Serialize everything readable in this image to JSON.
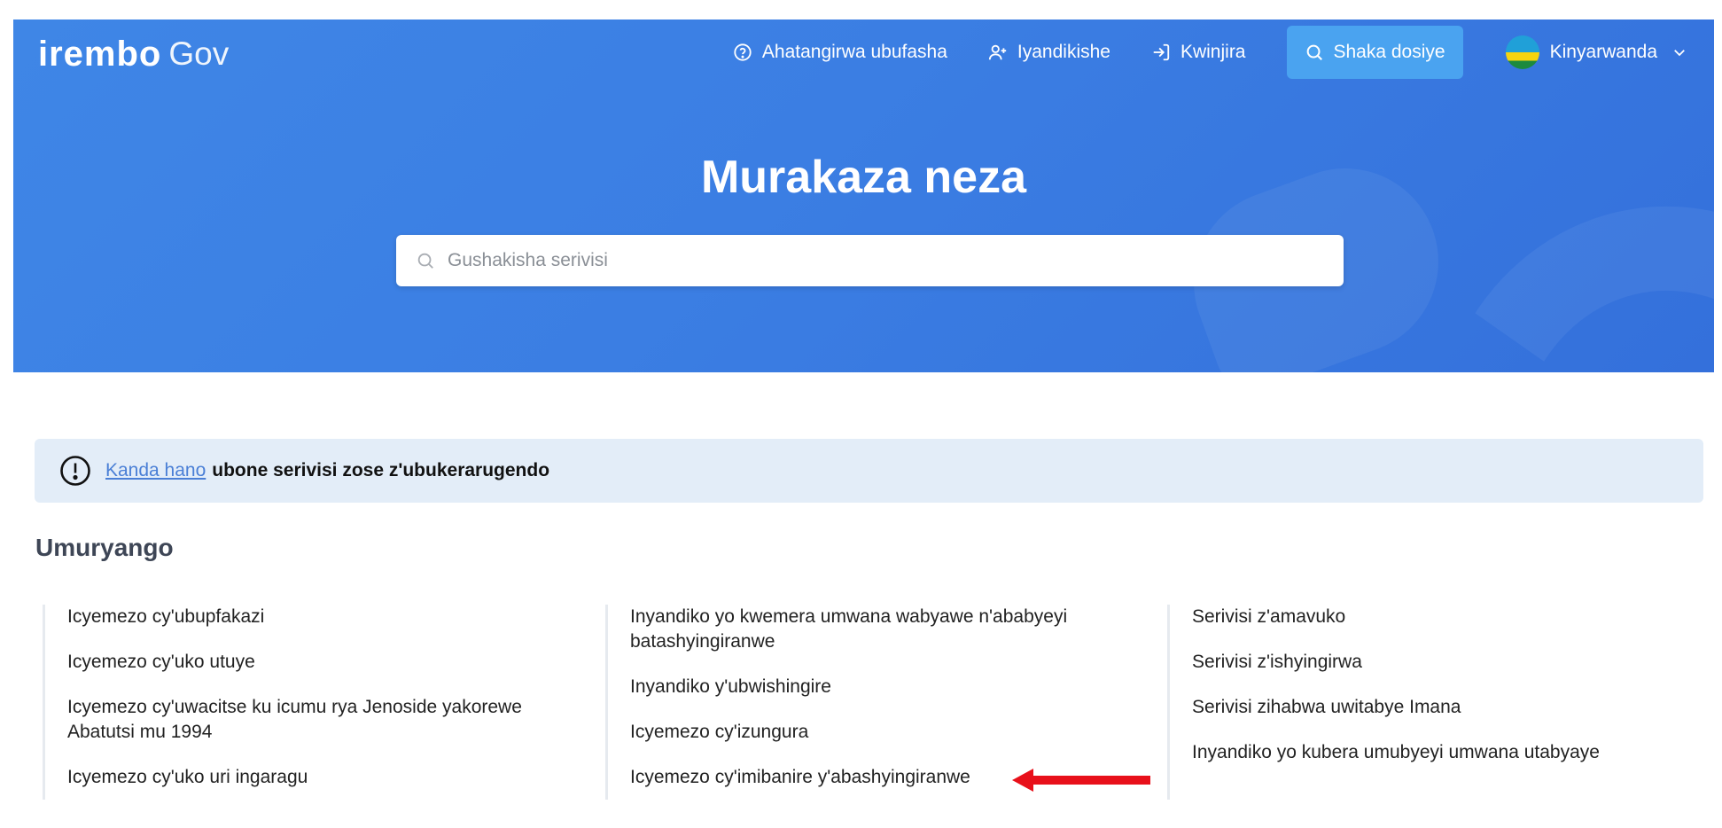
{
  "header": {
    "logo_brand": "irembo",
    "logo_gov": "Gov",
    "nav": {
      "help": "Ahatangirwa ubufasha",
      "register": "Iyandikishe",
      "login": "Kwinjira",
      "search_file": "Shaka dosiye",
      "language": "Kinyarwanda"
    }
  },
  "hero": {
    "title": "Murakaza neza",
    "search_placeholder": "Gushakisha serivisi"
  },
  "notice": {
    "link": "Kanda hano",
    "message": "ubone serivisi zose z'ubukerarugendo"
  },
  "section": {
    "title": "Umuryango",
    "columns": [
      [
        "Icyemezo cy'ubupfakazi",
        "Icyemezo cy'uko utuye",
        "Icyemezo cy'uwacitse ku icumu rya Jenoside yakorewe Abatutsi mu 1994",
        "Icyemezo cy'uko uri ingaragu"
      ],
      [
        "Inyandiko yo kwemera umwana wabyawe n'ababyeyi batashyingiranwe",
        "Inyandiko y'ubwishingire",
        "Icyemezo cy'izungura",
        "Icyemezo cy'imibanire y'abashyingiranwe"
      ],
      [
        "Serivisi z'amavuko",
        "Serivisi z'ishyingirwa",
        "Serivisi zihabwa uwitabye Imana",
        "Inyandiko yo kubera umubyeyi umwana utabyaye"
      ]
    ]
  },
  "colors": {
    "hero_blue": "#3b7ee3",
    "search_button": "#4aa3f0",
    "notice_bg": "#e3edf8",
    "link": "#4a7fd6",
    "arrow": "#e8101a"
  }
}
